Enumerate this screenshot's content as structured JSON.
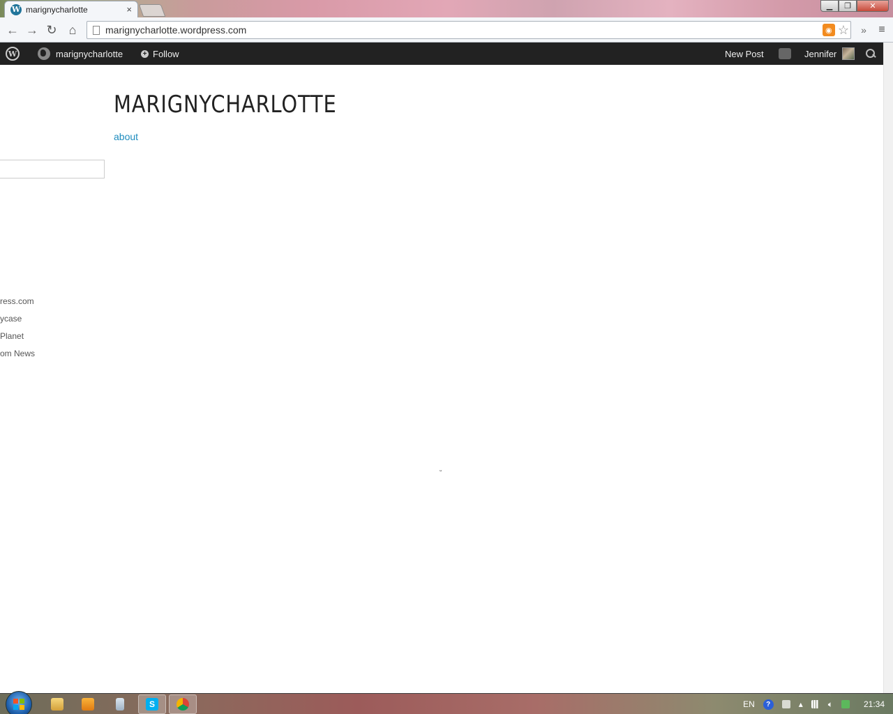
{
  "browser": {
    "tab_title": "marignycharlotte",
    "tab_close": "×",
    "url": "marignycharlotte.wordpress.com",
    "more_label": "»",
    "menu_label": "≡"
  },
  "adminbar": {
    "site_name": "marignycharlotte",
    "follow_label": "Follow",
    "new_post_label": "New Post",
    "user_name": "Jennifer"
  },
  "site": {
    "title": "MARIGNYCHARLOTTE",
    "nav": [
      "about"
    ]
  },
  "sidebar": {
    "links": [
      "ress.com",
      "ycase",
      "Planet",
      "om News"
    ]
  },
  "taskbar": {
    "language": "EN",
    "clock": "21:34",
    "apps": [
      "file-explorer",
      "media-player",
      "calculator",
      "skype",
      "chrome"
    ]
  },
  "colors": {
    "link": "#1e8cbe",
    "adminbar_bg": "#222222",
    "title": "#222222"
  }
}
